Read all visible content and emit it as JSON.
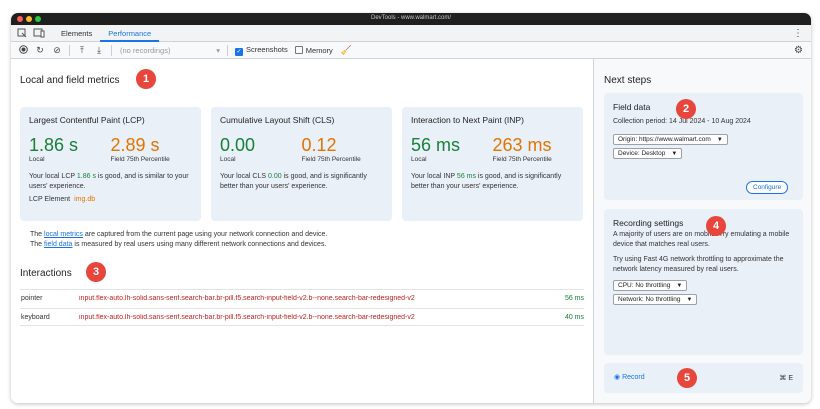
{
  "window": {
    "title": "DevTools - www.walmart.com/"
  },
  "tabs": [
    {
      "label": "Elements",
      "active": false
    },
    {
      "label": "Performance",
      "active": true
    }
  ],
  "toolbar": {
    "recordings_placeholder": "(no recordings)",
    "screenshots_label": "Screenshots",
    "screenshots_checked": true,
    "memory_label": "Memory",
    "memory_checked": false
  },
  "main": {
    "metrics_title": "Local and field metrics",
    "metrics_badge": "1",
    "cards": [
      {
        "title": "Largest Contentful Paint (LCP)",
        "local_value": "1.86 s",
        "local_label": "Local",
        "field_value": "2.89 s",
        "field_label": "Field 75th Percentile",
        "desc_pre": "Your local LCP ",
        "desc_value": "1.86 s",
        "desc_post": " is good, and is similar to your users' experience.",
        "element_label": "LCP Element",
        "element_value": "img.db"
      },
      {
        "title": "Cumulative Layout Shift (CLS)",
        "local_value": "0.00",
        "local_label": "Local",
        "field_value": "0.12",
        "field_label": "Field 75th Percentile",
        "desc_pre": "Your local CLS ",
        "desc_value": "0.00",
        "desc_post": " is good, and is significantly better than your users' experience."
      },
      {
        "title": "Interaction to Next Paint (INP)",
        "local_value": "56 ms",
        "local_label": "Local",
        "field_value": "263 ms",
        "field_label": "Field 75th Percentile",
        "desc_pre": "Your local INP ",
        "desc_value": "56 ms",
        "desc_post": " is good, and is significantly better than your users' experience."
      }
    ],
    "note": {
      "line1_pre": "The ",
      "line1_link": "local metrics",
      "line1_post": " are captured from the current page using your network connection and device.",
      "line2_pre": "The ",
      "line2_link": "field data",
      "line2_post": " is measured by real users using many different network connections and devices."
    },
    "interactions_title": "Interactions",
    "interactions_badge": "3",
    "interactions": [
      {
        "type": "pointer",
        "selector": "input.flex-auto.lh-solid.sans-serif.search-bar.br-pill.f5.search-input-field-v2.b--none.search-bar-redesigned-v2",
        "time": "56 ms"
      },
      {
        "type": "keyboard",
        "selector": "input.flex-auto.lh-solid.sans-serif.search-bar.br-pill.f5.search-input-field-v2.b--none.search-bar-redesigned-v2",
        "time": "40 ms"
      }
    ]
  },
  "side": {
    "title": "Next steps",
    "field": {
      "title": "Field data",
      "badge": "2",
      "period": "Collection period: 14 Jul 2024 - 10 Aug 2024",
      "origin": "Origin: https://www.walmart.com",
      "device": "Device: Desktop",
      "configure": "Configure"
    },
    "recording": {
      "title": "Recording settings",
      "badge": "4",
      "text1": "A majority of users are on mobile. Try emulating a mobile device that matches real users.",
      "text2": "Try using Fast 4G network throttling to approximate the network latency measured by real users.",
      "cpu": "CPU: No throttling",
      "network": "Network: No throttling"
    },
    "record": {
      "label": "Record",
      "badge": "5",
      "shortcut": "⌘ E"
    }
  },
  "colors": {
    "accent": "#1a73e8",
    "good": "#188038",
    "needs_improvement": "#e37400",
    "badge": "#e8453c"
  }
}
